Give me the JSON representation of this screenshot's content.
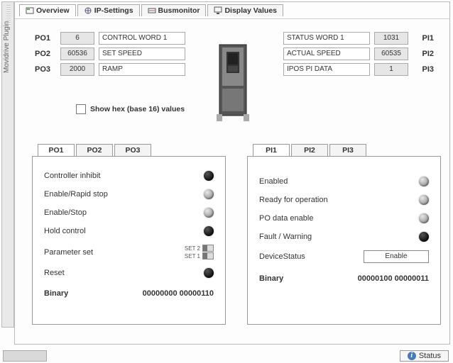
{
  "side_label": "Movidrive Plugin",
  "tabs": {
    "overview": "Overview",
    "ip": "IP-Settings",
    "bus": "Busmonitor",
    "display": "Display Values"
  },
  "po": [
    {
      "lab": "PO1",
      "val": "6",
      "name": "CONTROL WORD 1"
    },
    {
      "lab": "PO2",
      "val": "60536",
      "name": "SET SPEED"
    },
    {
      "lab": "PO3",
      "val": "2000",
      "name": "RAMP"
    }
  ],
  "pi": [
    {
      "lab": "PI1",
      "val": "1031",
      "name": "STATUS WORD 1"
    },
    {
      "lab": "PI2",
      "val": "60535",
      "name": "ACTUAL SPEED"
    },
    {
      "lab": "PI3",
      "val": "1",
      "name": "IPOS PI DATA"
    }
  ],
  "hex_label": "Show hex (base 16) values",
  "po_panel": {
    "tabs": [
      "PO1",
      "PO2",
      "PO3"
    ],
    "rows": {
      "inhibit": "Controller inhibit",
      "rapid": "Enable/Rapid stop",
      "estop": "Enable/Stop",
      "hold": "Hold control",
      "param": "Parameter set",
      "reset": "Reset"
    },
    "paramset": {
      "set2": "SET 2",
      "set1": "SET 1"
    },
    "binary_label": "Binary",
    "binary_value": "00000000  00000110"
  },
  "pi_panel": {
    "tabs": [
      "PI1",
      "PI2",
      "PI3"
    ],
    "rows": {
      "enabled": "Enabled",
      "ready": "Ready for operation",
      "podata": "PO data enable",
      "fault": "Fault / Warning",
      "devstat": "DeviceStatus"
    },
    "devstat_value": "Enable",
    "binary_label": "Binary",
    "binary_value": "00000100 00000011"
  },
  "status_btn": "Status"
}
